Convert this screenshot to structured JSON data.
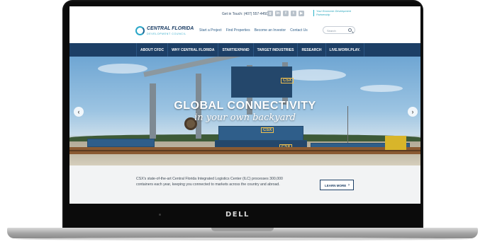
{
  "device": {
    "brand": "DELL"
  },
  "topbar": {
    "get_in_touch": "Get in Touch: (407) 557-4450",
    "socials": [
      "gplus-icon",
      "linkedin-icon",
      "facebook-icon",
      "twitter-icon",
      "youtube-icon"
    ],
    "partner": "Your Economic Development Partnership"
  },
  "logo": {
    "name": "CENTRAL FLORIDA",
    "sub": "DEVELOPMENT COUNCIL"
  },
  "utility_nav": [
    "Start a Project",
    "Find Properties",
    "Become an Investor",
    "Contact Us"
  ],
  "search": {
    "placeholder": "Search"
  },
  "main_nav": [
    "ABOUT CFDC",
    "WHY CENTRAL FLORIDA",
    "START/EXPAND",
    "TARGET INDUSTRIES",
    "RESEARCH",
    "LIVE.WORK.PLAY."
  ],
  "hero": {
    "title": "GLOBAL CONNECTIVITY",
    "subtitle": "in your own backyard",
    "container_brand": "CSX"
  },
  "caption": {
    "text": "CSX's state-of-the-art Central Florida Integrated Logistics Center (ILC) processes 300,000 containers each year, keeping you connected to markets across the country and abroad.",
    "button": "LEARN MORE"
  },
  "colors": {
    "navy": "#1d3f66",
    "teal": "#2aa7c8",
    "caption_bg": "#f2f3f4"
  }
}
